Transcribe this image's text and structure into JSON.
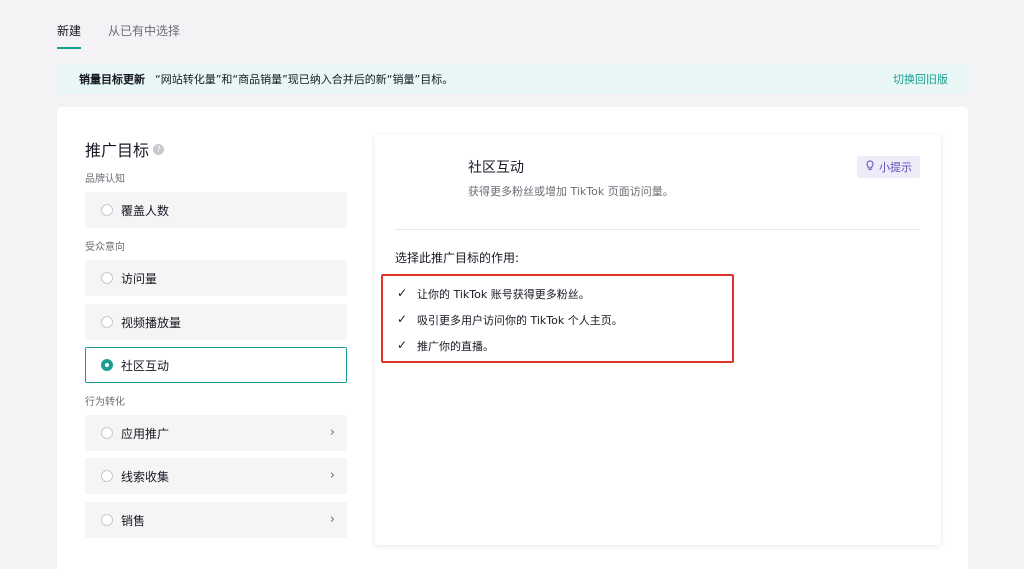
{
  "tabs": [
    {
      "label": "新建",
      "active": true
    },
    {
      "label": "从已有中选择",
      "active": false
    }
  ],
  "banner": {
    "title": "销量目标更新",
    "text": "“网站转化量”和“商品销量”现已纳入合并后的新“销量”目标。",
    "link": "切换回旧版"
  },
  "objective": {
    "title": "推广目标",
    "help_icon": "question-circle-icon",
    "groups": [
      {
        "label": "品牌认知",
        "options": [
          {
            "label": "覆盖人数",
            "selected": false,
            "has_chevron": false
          }
        ]
      },
      {
        "label": "受众意向",
        "options": [
          {
            "label": "访问量",
            "selected": false,
            "has_chevron": false
          },
          {
            "label": "视频播放量",
            "selected": false,
            "has_chevron": false
          },
          {
            "label": "社区互动",
            "selected": true,
            "has_chevron": false
          }
        ]
      },
      {
        "label": "行为转化",
        "options": [
          {
            "label": "应用推广",
            "selected": false,
            "has_chevron": true
          },
          {
            "label": "线索收集",
            "selected": false,
            "has_chevron": true
          },
          {
            "label": "销售",
            "selected": false,
            "has_chevron": true
          }
        ]
      }
    ]
  },
  "detail": {
    "title": "社区互动",
    "description": "获得更多粉丝或增加 TikTok 页面访问量。",
    "tip_label": "小提示",
    "tip_icon": "lightbulb-icon",
    "purpose_title": "选择此推广目标的作用:",
    "purposes": [
      "让你的 TikTok 账号获得更多粉丝。",
      "吸引更多用户访问你的 TikTok 个人主页。",
      "推广你的直播。"
    ]
  },
  "colors": {
    "accent": "#1a9e94",
    "highlight": "#e0332a",
    "tip": "#5a4fb8"
  }
}
